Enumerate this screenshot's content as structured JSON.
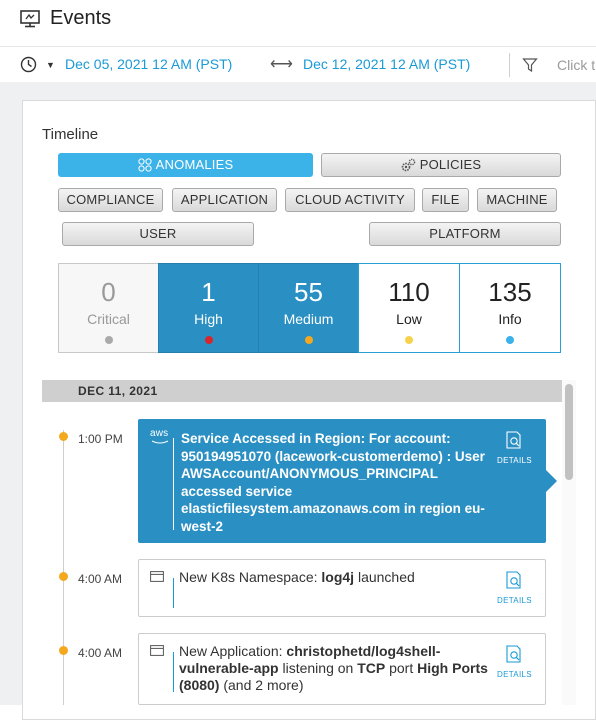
{
  "header": {
    "title": "Events",
    "icon": "events-monitor-icon"
  },
  "time_filter": {
    "start": "Dec 05, 2021 12 AM (PST)",
    "separator": "⟷",
    "end": "Dec 12, 2021 12 AM (PST)",
    "filter_placeholder": "Click t"
  },
  "timeline": {
    "title": "Timeline",
    "view_tabs": [
      {
        "label": "ANOMALIES",
        "active": true,
        "icon": "anomalies-icon"
      },
      {
        "label": "POLICIES",
        "active": false,
        "icon": "gears-icon"
      }
    ],
    "categories": [
      "COMPLIANCE",
      "APPLICATION",
      "CLOUD ACTIVITY",
      "FILE",
      "MACHINE",
      "USER",
      "PLATFORM"
    ],
    "severities": [
      {
        "count": "0",
        "label": "Critical",
        "color": "#aaaaaa",
        "state": "dim"
      },
      {
        "count": "1",
        "label": "High",
        "color": "#d9262a",
        "state": "selected"
      },
      {
        "count": "55",
        "label": "Medium",
        "color": "#f4a81d",
        "state": "selected"
      },
      {
        "count": "110",
        "label": "Low",
        "color": "#f6d34a",
        "state": "normal"
      },
      {
        "count": "135",
        "label": "Info",
        "color": "#3bb2e8",
        "state": "normal"
      }
    ],
    "day_header": "DEC 11, 2021",
    "details_label": "DETAILS",
    "events": [
      {
        "time": "1:00 PM",
        "source_icon": "aws-logo",
        "source_label": "aws",
        "text": "Service Accessed in Region: For account: 950194951070 (lacework-customerdemo) : User AWSAccount/ANONYMOUS_PRINCIPAL accessed service elasticfilesystem.amazonaws.com in region eu-west-2",
        "selected": true
      },
      {
        "time": "4:00 AM",
        "source_icon": "window-icon",
        "parts": [
          {
            "t": "New K8s Namespace: ",
            "b": false
          },
          {
            "t": "log4j",
            "b": true
          },
          {
            "t": " launched",
            "b": false
          }
        ],
        "selected": false
      },
      {
        "time": "4:00 AM",
        "source_icon": "window-icon",
        "parts": [
          {
            "t": "New Application: ",
            "b": false
          },
          {
            "t": "christophetd/log4shell-vulnerable-app",
            "b": true
          },
          {
            "t": " listening on ",
            "b": false
          },
          {
            "t": "TCP",
            "b": true
          },
          {
            "t": " port ",
            "b": false
          },
          {
            "t": "High Ports (8080)",
            "b": true
          },
          {
            "t": " (and 2 more)",
            "b": false
          }
        ],
        "selected": false
      }
    ]
  }
}
